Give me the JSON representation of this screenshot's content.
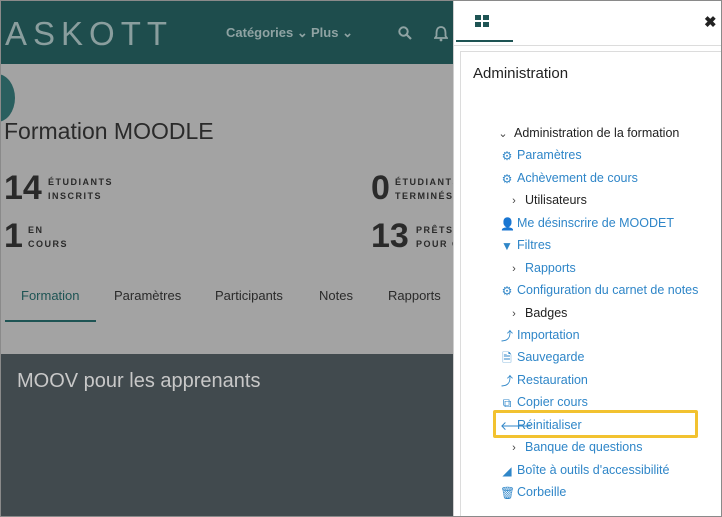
{
  "header": {
    "logo_text": "ASKOTT",
    "nav_categories": "Catégories",
    "nav_plus": "Plus"
  },
  "course": {
    "title": "Formation MOODLE",
    "stats": [
      {
        "num": "14",
        "line1": "ÉTUDIANTS",
        "line2": "INSCRITS"
      },
      {
        "num": "0",
        "line1": "ÉTUDIANTS",
        "line2": "TERMINÉS"
      },
      {
        "num": "1",
        "line1": "EN",
        "line2": "COURS"
      },
      {
        "num": "13",
        "line1": "PRÊTS",
        "line2": "POUR C"
      }
    ],
    "tabs": [
      "Formation",
      "Paramètres",
      "Participants",
      "Notes",
      "Rapports"
    ],
    "section_title": "MOOV pour les apprenants"
  },
  "drawer": {
    "title": "Administration",
    "close_glyph": "✖",
    "tree": [
      {
        "label": "Administration de la formation",
        "icon": "chevron-down-icon",
        "glyph": "⌄",
        "style": "dark"
      },
      {
        "label": "Paramètres",
        "icon": "gear-icon",
        "glyph": "⚙",
        "style": "blue"
      },
      {
        "label": "Achèvement de cours",
        "icon": "gear-icon",
        "glyph": "⚙",
        "style": "blue"
      },
      {
        "label": "Utilisateurs",
        "icon": "chevron-right-icon",
        "glyph": "›",
        "style": "dark"
      },
      {
        "label": "Me désinscrire de MOODET",
        "icon": "user-icon",
        "glyph": "👤",
        "style": "blue"
      },
      {
        "label": "Filtres",
        "icon": "filter-icon",
        "glyph": "▼",
        "style": "blue"
      },
      {
        "label": "Rapports",
        "icon": "chevron-right-icon",
        "glyph": "›",
        "style": "blue"
      },
      {
        "label": "Configuration du carnet de notes",
        "icon": "gear-icon",
        "glyph": "⚙",
        "style": "blue"
      },
      {
        "label": "Badges",
        "icon": "chevron-right-icon",
        "glyph": "›",
        "style": "dark"
      },
      {
        "label": "Importation",
        "icon": "import-icon",
        "glyph": "⤴",
        "style": "blue"
      },
      {
        "label": "Sauvegarde",
        "icon": "file-archive-icon",
        "glyph": "🗎",
        "style": "blue"
      },
      {
        "label": "Restauration",
        "icon": "restore-icon",
        "glyph": "⤴",
        "style": "blue"
      },
      {
        "label": "Copier cours",
        "icon": "copy-icon",
        "glyph": "⧉",
        "style": "blue"
      },
      {
        "label": "Réinitialiser",
        "icon": "arrow-left-icon",
        "glyph": "🡐",
        "style": "blue"
      },
      {
        "label": "Banque de questions",
        "icon": "chevron-right-icon",
        "glyph": "›",
        "style": "blue"
      },
      {
        "label": "Boîte à outils d'accessibilité",
        "icon": "area-chart-icon",
        "glyph": "◢",
        "style": "blue"
      },
      {
        "label": "Corbeille",
        "icon": "trash-icon",
        "glyph": "🗑",
        "style": "blue"
      }
    ]
  },
  "colors": {
    "highlight": "#f2c230",
    "link": "#2f86c8",
    "brand": "#1e4d4d"
  }
}
